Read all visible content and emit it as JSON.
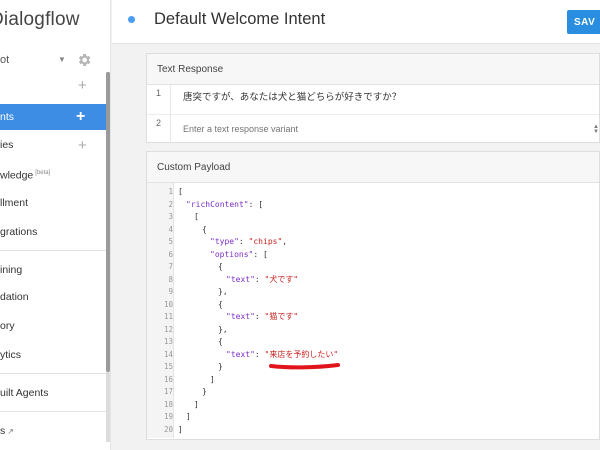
{
  "sidebar": {
    "logo": "Dialogflow",
    "agent": "ot",
    "items": [
      {
        "label": "nts"
      },
      {
        "label": "ies"
      },
      {
        "label": "wledge",
        "badge": "[beta]"
      },
      {
        "label": "llment"
      },
      {
        "label": "grations"
      },
      {
        "label": "ining"
      },
      {
        "label": "dation"
      },
      {
        "label": "ory"
      },
      {
        "label": "ytics"
      },
      {
        "label": "uilt Agents"
      },
      {
        "label": "s"
      }
    ]
  },
  "header": {
    "title": "Default Welcome Intent",
    "save_label": "SAV"
  },
  "text_response": {
    "title": "Text Response",
    "rows": [
      {
        "num": "1",
        "text": "唐突ですが、あなたは犬と猫どちらが好きですか？"
      },
      {
        "num": "2",
        "placeholder": "Enter a text response variant"
      }
    ]
  },
  "custom_payload": {
    "title": "Custom Payload",
    "line_numbers": [
      "1",
      "2",
      "3",
      "4",
      "5",
      "6",
      "7",
      "8",
      "9",
      "10",
      "11",
      "12",
      "13",
      "14",
      "15",
      "16",
      "17",
      "18",
      "19",
      "20"
    ],
    "code": {
      "l1": "[",
      "l2_k": "\"richContent\"",
      "l2_r": ": [",
      "l3": "[",
      "l4": "{",
      "l5_k": "\"type\"",
      "l5_m": ": ",
      "l5_v": "\"chips\"",
      "l5_r": ",",
      "l6_k": "\"options\"",
      "l6_r": ": [",
      "l7": "{",
      "l8_k": "\"text\"",
      "l8_m": ": ",
      "l8_v": "\"犬です\"",
      "l9": "},",
      "l10": "{",
      "l11_k": "\"text\"",
      "l11_m": ": ",
      "l11_v": "\"猫です\"",
      "l12": "},",
      "l13": "{",
      "l14_k": "\"text\"",
      "l14_m": ": ",
      "l14_v": "\"来店を予約したい\"",
      "l15": "}",
      "l16": "]",
      "l17": "}",
      "l18": "]",
      "l19": "]",
      "l20": "]"
    }
  },
  "colors": {
    "accent": "#3d8de4",
    "json_key": "#7a2ec8",
    "json_string": "#c9211f",
    "annotation": "#e0141a"
  }
}
